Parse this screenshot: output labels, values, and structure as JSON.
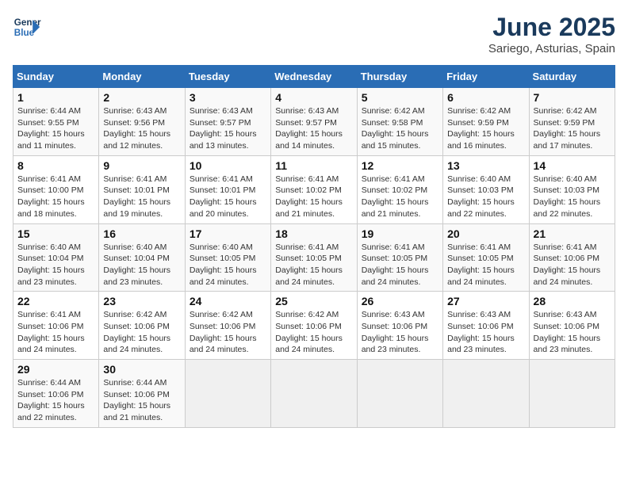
{
  "header": {
    "logo_line1": "General",
    "logo_line2": "Blue",
    "title": "June 2025",
    "subtitle": "Sariego, Asturias, Spain"
  },
  "calendar": {
    "days_of_week": [
      "Sunday",
      "Monday",
      "Tuesday",
      "Wednesday",
      "Thursday",
      "Friday",
      "Saturday"
    ],
    "weeks": [
      [
        {
          "day": "",
          "info": ""
        },
        {
          "day": "",
          "info": ""
        },
        {
          "day": "",
          "info": ""
        },
        {
          "day": "",
          "info": ""
        },
        {
          "day": "",
          "info": ""
        },
        {
          "day": "",
          "info": ""
        },
        {
          "day": "",
          "info": ""
        }
      ]
    ],
    "cells": [
      [
        {
          "day": "1",
          "sunrise": "6:44 AM",
          "sunset": "9:55 PM",
          "daylight": "15 hours and 11 minutes."
        },
        {
          "day": "2",
          "sunrise": "6:43 AM",
          "sunset": "9:56 PM",
          "daylight": "15 hours and 12 minutes."
        },
        {
          "day": "3",
          "sunrise": "6:43 AM",
          "sunset": "9:57 PM",
          "daylight": "15 hours and 13 minutes."
        },
        {
          "day": "4",
          "sunrise": "6:43 AM",
          "sunset": "9:57 PM",
          "daylight": "15 hours and 14 minutes."
        },
        {
          "day": "5",
          "sunrise": "6:42 AM",
          "sunset": "9:58 PM",
          "daylight": "15 hours and 15 minutes."
        },
        {
          "day": "6",
          "sunrise": "6:42 AM",
          "sunset": "9:59 PM",
          "daylight": "15 hours and 16 minutes."
        },
        {
          "day": "7",
          "sunrise": "6:42 AM",
          "sunset": "9:59 PM",
          "daylight": "15 hours and 17 minutes."
        }
      ],
      [
        {
          "day": "8",
          "sunrise": "6:41 AM",
          "sunset": "10:00 PM",
          "daylight": "15 hours and 18 minutes."
        },
        {
          "day": "9",
          "sunrise": "6:41 AM",
          "sunset": "10:01 PM",
          "daylight": "15 hours and 19 minutes."
        },
        {
          "day": "10",
          "sunrise": "6:41 AM",
          "sunset": "10:01 PM",
          "daylight": "15 hours and 20 minutes."
        },
        {
          "day": "11",
          "sunrise": "6:41 AM",
          "sunset": "10:02 PM",
          "daylight": "15 hours and 21 minutes."
        },
        {
          "day": "12",
          "sunrise": "6:41 AM",
          "sunset": "10:02 PM",
          "daylight": "15 hours and 21 minutes."
        },
        {
          "day": "13",
          "sunrise": "6:40 AM",
          "sunset": "10:03 PM",
          "daylight": "15 hours and 22 minutes."
        },
        {
          "day": "14",
          "sunrise": "6:40 AM",
          "sunset": "10:03 PM",
          "daylight": "15 hours and 22 minutes."
        }
      ],
      [
        {
          "day": "15",
          "sunrise": "6:40 AM",
          "sunset": "10:04 PM",
          "daylight": "15 hours and 23 minutes."
        },
        {
          "day": "16",
          "sunrise": "6:40 AM",
          "sunset": "10:04 PM",
          "daylight": "15 hours and 23 minutes."
        },
        {
          "day": "17",
          "sunrise": "6:40 AM",
          "sunset": "10:05 PM",
          "daylight": "15 hours and 24 minutes."
        },
        {
          "day": "18",
          "sunrise": "6:41 AM",
          "sunset": "10:05 PM",
          "daylight": "15 hours and 24 minutes."
        },
        {
          "day": "19",
          "sunrise": "6:41 AM",
          "sunset": "10:05 PM",
          "daylight": "15 hours and 24 minutes."
        },
        {
          "day": "20",
          "sunrise": "6:41 AM",
          "sunset": "10:05 PM",
          "daylight": "15 hours and 24 minutes."
        },
        {
          "day": "21",
          "sunrise": "6:41 AM",
          "sunset": "10:06 PM",
          "daylight": "15 hours and 24 minutes."
        }
      ],
      [
        {
          "day": "22",
          "sunrise": "6:41 AM",
          "sunset": "10:06 PM",
          "daylight": "15 hours and 24 minutes."
        },
        {
          "day": "23",
          "sunrise": "6:42 AM",
          "sunset": "10:06 PM",
          "daylight": "15 hours and 24 minutes."
        },
        {
          "day": "24",
          "sunrise": "6:42 AM",
          "sunset": "10:06 PM",
          "daylight": "15 hours and 24 minutes."
        },
        {
          "day": "25",
          "sunrise": "6:42 AM",
          "sunset": "10:06 PM",
          "daylight": "15 hours and 24 minutes."
        },
        {
          "day": "26",
          "sunrise": "6:43 AM",
          "sunset": "10:06 PM",
          "daylight": "15 hours and 23 minutes."
        },
        {
          "day": "27",
          "sunrise": "6:43 AM",
          "sunset": "10:06 PM",
          "daylight": "15 hours and 23 minutes."
        },
        {
          "day": "28",
          "sunrise": "6:43 AM",
          "sunset": "10:06 PM",
          "daylight": "15 hours and 23 minutes."
        }
      ],
      [
        {
          "day": "29",
          "sunrise": "6:44 AM",
          "sunset": "10:06 PM",
          "daylight": "15 hours and 22 minutes."
        },
        {
          "day": "30",
          "sunrise": "6:44 AM",
          "sunset": "10:06 PM",
          "daylight": "15 hours and 21 minutes."
        },
        {
          "day": "",
          "sunrise": "",
          "sunset": "",
          "daylight": ""
        },
        {
          "day": "",
          "sunrise": "",
          "sunset": "",
          "daylight": ""
        },
        {
          "day": "",
          "sunrise": "",
          "sunset": "",
          "daylight": ""
        },
        {
          "day": "",
          "sunrise": "",
          "sunset": "",
          "daylight": ""
        },
        {
          "day": "",
          "sunrise": "",
          "sunset": "",
          "daylight": ""
        }
      ]
    ]
  }
}
